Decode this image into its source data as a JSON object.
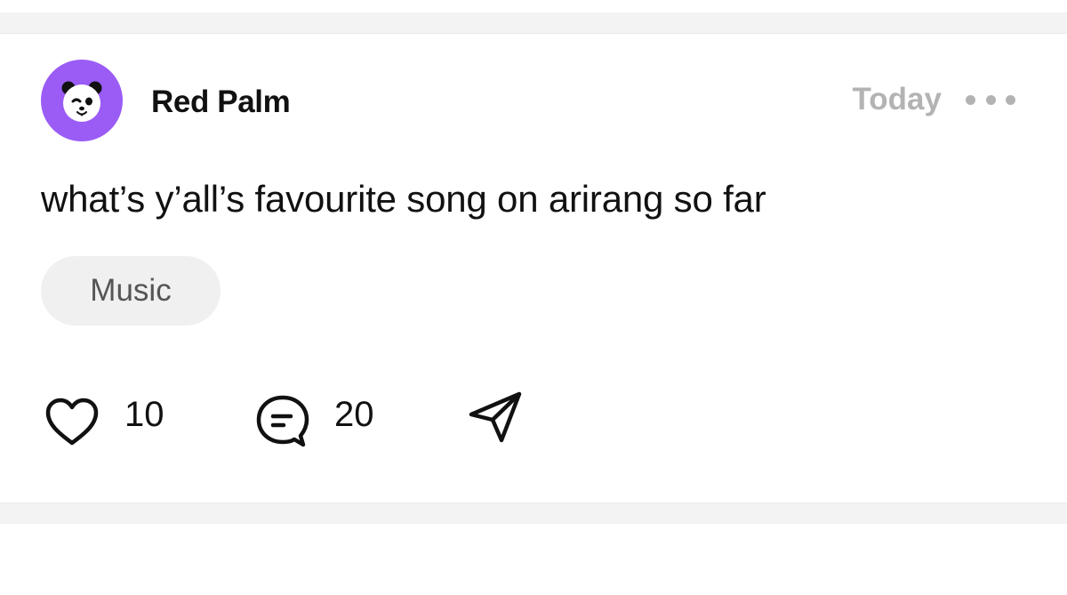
{
  "post": {
    "author": "Red Palm",
    "timestamp": "Today",
    "more_icon": "more-horizontal-icon",
    "avatar": {
      "icon": "panda-face-icon",
      "background": "#9a5cf5"
    },
    "text": "what’s y’all’s favourite song on arirang so far",
    "tag": "Music",
    "actions": {
      "like": {
        "icon": "heart-icon",
        "count": "10"
      },
      "comment": {
        "icon": "comment-bubble-icon",
        "count": "20"
      },
      "share": {
        "icon": "send-icon"
      }
    }
  },
  "colors": {
    "muted": "#b3b3b3",
    "tag_background": "#f0f0f0",
    "separator": "#f3f3f3"
  }
}
